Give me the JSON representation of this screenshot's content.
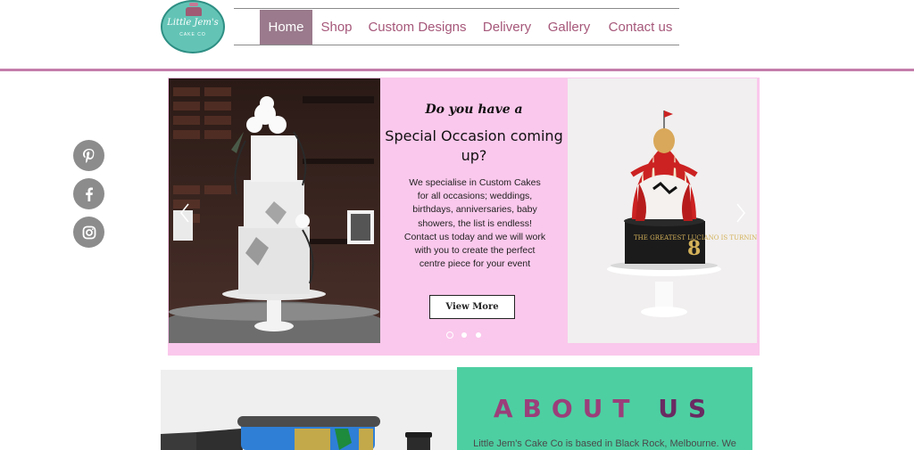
{
  "logo": {
    "line1": "Little Jem's",
    "line2": "CAKE CO"
  },
  "nav": {
    "items": [
      {
        "label": "Home",
        "active": true
      },
      {
        "label": "Shop"
      },
      {
        "label": "Custom Designs"
      },
      {
        "label": "Delivery"
      },
      {
        "label": "Gallery"
      },
      {
        "label": "Contact us"
      }
    ]
  },
  "social": [
    {
      "name": "pinterest-icon"
    },
    {
      "name": "facebook-icon"
    },
    {
      "name": "instagram-icon"
    }
  ],
  "hero": {
    "script_text": "Do you have a",
    "heading": "Special Occasion coming up?",
    "body": "We specialise in Custom Cakes for all occasions; weddings, birthdays, anniversaries, baby showers, the list is endless! Contact us today and we will work with you to create the perfect centre piece for your event",
    "button_label": "View More",
    "slide_count": 3,
    "active_slide": 1,
    "cake_topper": "THE GREATEST LUCIANO IS TURNING",
    "cake_number": "8"
  },
  "about": {
    "title_part1": "ABOUT",
    "title_part2": "US",
    "text": "Little Jem's Cake Co is based in Black Rock, Melbourne. We"
  },
  "colors": {
    "accent": "#a6587a",
    "header_rule": "#c37dab",
    "hero_bg": "#fac8ec",
    "about_bg": "#4dcfa2"
  }
}
